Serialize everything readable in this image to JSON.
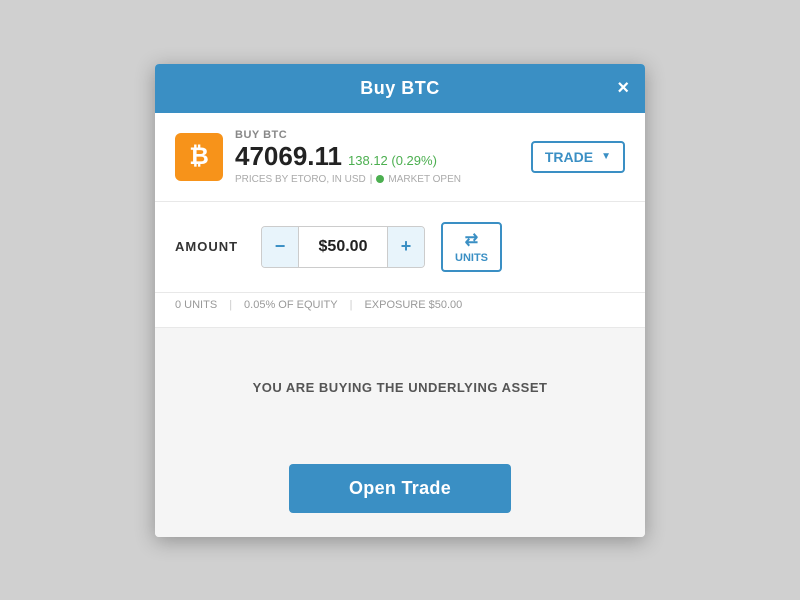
{
  "modal": {
    "title": "Buy BTC",
    "close_label": "×"
  },
  "asset": {
    "buy_label": "BUY BTC",
    "price": "47069.11",
    "change": "138.12 (0.29%)",
    "meta": "PRICES BY ETORO, IN USD",
    "market_status": "MARKET OPEN",
    "icon_symbol": "₿"
  },
  "trade_dropdown": {
    "label": "TRADE",
    "arrow": "▼"
  },
  "amount": {
    "label": "AMOUNT",
    "minus": "−",
    "value": "$50.00",
    "plus": "+",
    "units_label": "UNITS",
    "units_icon": "⇄"
  },
  "amount_details": {
    "units": "0 UNITS",
    "equity": "0.05% OF EQUITY",
    "exposure": "EXPOSURE $50.00"
  },
  "info": {
    "text": "YOU ARE BUYING THE UNDERLYING ASSET"
  },
  "footer": {
    "open_trade_label": "Open Trade"
  }
}
